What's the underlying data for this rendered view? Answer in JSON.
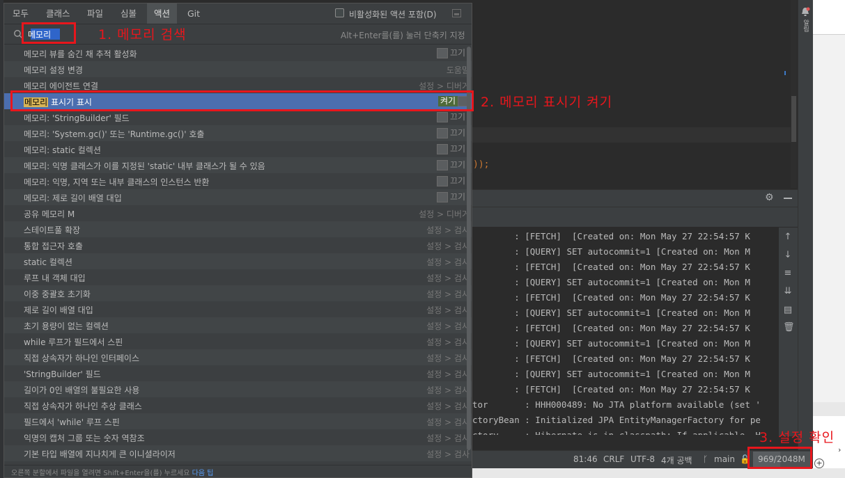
{
  "popup": {
    "tabs": [
      {
        "label": "모두",
        "active": false
      },
      {
        "label": "클래스",
        "active": false
      },
      {
        "label": "파일",
        "active": false
      },
      {
        "label": "심볼",
        "active": false
      },
      {
        "label": "액션",
        "active": true
      },
      {
        "label": "Git",
        "active": false
      }
    ],
    "include_disabled_label": "비활성화된 액션 포함(D)",
    "search": {
      "value": "메모리",
      "hint": "Alt+Enter를(를) 눌러 단축키 지정"
    },
    "results": [
      {
        "label": "메모리 뷰를 숨긴 채 추적 활성화",
        "right": "",
        "toggle": "끄기"
      },
      {
        "label": "메모리 설정 변경",
        "right": "도움말",
        "toggle": ""
      },
      {
        "label": "메모리 에이전트 연결",
        "right": "설정 > 디버거",
        "toggle": ""
      },
      {
        "label_match": "메모리",
        "label_rest": " 표시기 표시",
        "right": "",
        "toggle": "켜기",
        "selected": true
      },
      {
        "label": "메모리: 'StringBuilder' 필드",
        "right": "",
        "toggle": "끄기"
      },
      {
        "label": "메모리: 'System.gc()' 또는 'Runtime.gc()' 호출",
        "right": "",
        "toggle": "끄기"
      },
      {
        "label": "메모리: static 컬렉션",
        "right": "",
        "toggle": "끄기"
      },
      {
        "label": "메모리: 익명 클래스가 이를 지정된 'static' 내부 클래스가 될 수 있음",
        "right": "",
        "toggle": "끄기"
      },
      {
        "label": "메모리: 익명, 지역 또는 내부 클래스의 인스턴스 반환",
        "right": "",
        "toggle": "끄기"
      },
      {
        "label": "메모리: 제로 길이 배열 대입",
        "right": "",
        "toggle": "끄기"
      },
      {
        "label": "공유 메모리 M",
        "right": "설정 > 디버거",
        "toggle": ""
      },
      {
        "label": "스테이트풀 확장",
        "right": "설정 > 검사",
        "toggle": ""
      },
      {
        "label": "통합 접근자 호출",
        "right": "설정 > 검사",
        "toggle": ""
      },
      {
        "label": "static 컬렉션",
        "right": "설정 > 검사",
        "toggle": ""
      },
      {
        "label": "루프 내 객체 대입",
        "right": "설정 > 검사",
        "toggle": ""
      },
      {
        "label": "이중 중괄호 초기화",
        "right": "설정 > 검사",
        "toggle": ""
      },
      {
        "label": "제로 길이 배열 대입",
        "right": "설정 > 검사",
        "toggle": ""
      },
      {
        "label": "초기 용량이 없는 컬렉션",
        "right": "설정 > 검사",
        "toggle": ""
      },
      {
        "label": "while 루프가 필드에서 스핀",
        "right": "설정 > 검사",
        "toggle": ""
      },
      {
        "label": "직접 상속자가 하나인 인터페이스",
        "right": "설정 > 검사",
        "toggle": ""
      },
      {
        "label": "'StringBuilder' 필드",
        "right": "설정 > 검사",
        "toggle": ""
      },
      {
        "label": "길이가 0인 배열의 불필요한 사용",
        "right": "설정 > 검사",
        "toggle": ""
      },
      {
        "label": "직접 상속자가 하나인 추상 클래스",
        "right": "설정 > 검사",
        "toggle": ""
      },
      {
        "label": "필드에서 'while' 루프 스핀",
        "right": "설정 > 검사",
        "toggle": ""
      },
      {
        "label": "익명의 캡처 그룹 또는 숫자 역참조",
        "right": "설정 > 검사",
        "toggle": ""
      },
      {
        "label": "기본 타입 배열에 지나치게 큰 이니셜라이저",
        "right": "설정 > 검사",
        "toggle": ""
      }
    ],
    "footer_text": "오른쪽 분할에서 파일을 열려면 Shift+Enter을(를) 누르세요",
    "footer_link": "다음 팁"
  },
  "editor": {
    "code_fragment": "));"
  },
  "console": {
    "lines": [
      "        : [FETCH]  [Created on: Mon May 27 22:54:57 K",
      "        : [QUERY] SET autocommit=1 [Created on: Mon M",
      "        : [FETCH]  [Created on: Mon May 27 22:54:57 K",
      "        : [QUERY] SET autocommit=1 [Created on: Mon M",
      "        : [FETCH]  [Created on: Mon May 27 22:54:57 K",
      "        : [QUERY] SET autocommit=1 [Created on: Mon M",
      "        : [FETCH]  [Created on: Mon May 27 22:54:57 K",
      "        : [QUERY] SET autocommit=1 [Created on: Mon M",
      "        : [FETCH]  [Created on: Mon May 27 22:54:57 K",
      "        : [QUERY] SET autocommit=1 [Created on: Mon M",
      "        : [FETCH]  [Created on: Mon May 27 22:54:57 K",
      "tor       : HHH000489: No JTA platform available (set '",
      "ctoryBean : Initialized JPA EntityManagerFactory for pe",
      "ctory     : Hibernate is in classpath; If applicable, H"
    ]
  },
  "status_bar": {
    "position": "81:46",
    "line_sep": "CRLF",
    "encoding": "UTF-8",
    "indent": "4개 공백",
    "branch": "main",
    "memory": "969/2048M",
    "memory_used_mb": 969,
    "memory_total_mb": 2048
  },
  "right_bar": {
    "notifications_label": "알림"
  },
  "annotations": {
    "step1": "1. 메모리 검색",
    "step2": "2. 메모리 표시기 켜기",
    "step3": "3. 설정 확인",
    "color": "#e8161c"
  }
}
